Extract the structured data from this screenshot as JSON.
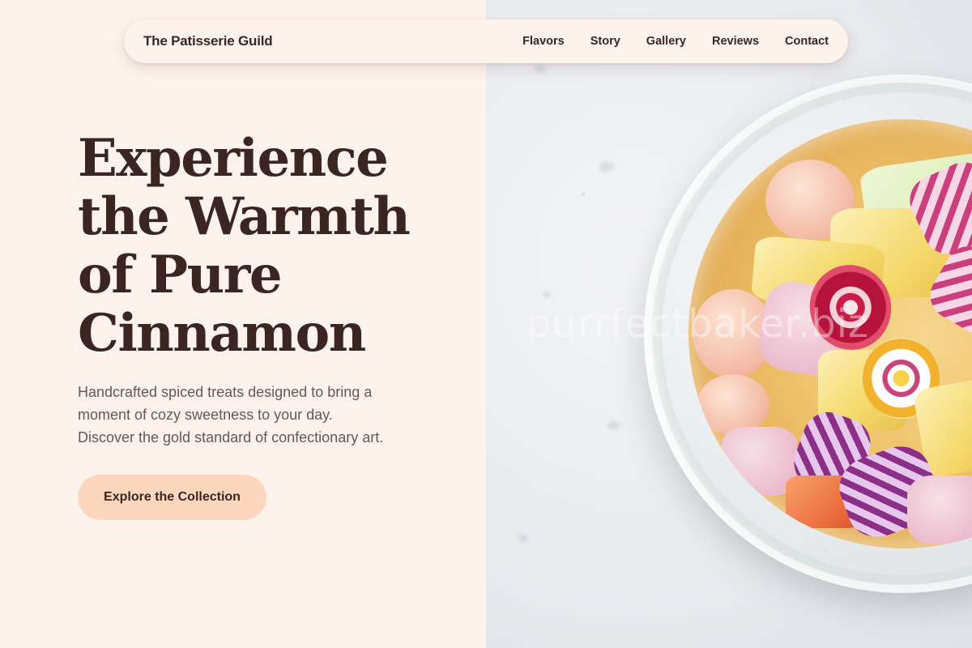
{
  "nav": {
    "brand": "The Patisserie Guild",
    "links": [
      "Flavors",
      "Story",
      "Gallery",
      "Reviews",
      "Contact"
    ]
  },
  "hero": {
    "title_lines": [
      "Experience",
      "the Warmth",
      "of Pure",
      "Cinnamon"
    ],
    "subtitle_lines": [
      "Handcrafted spiced treats designed to bring a",
      "moment of cozy sweetness to your day.",
      "Discover the gold standard of confectionary art."
    ],
    "cta_label": "Explore the Collection"
  },
  "image": {
    "watermark": "purrfectbaker.biz"
  },
  "colors": {
    "background": "#fdf3ec",
    "text_dark": "#3b2521",
    "text_muted": "#6b5550",
    "cta_background": "#fcd7bd"
  }
}
